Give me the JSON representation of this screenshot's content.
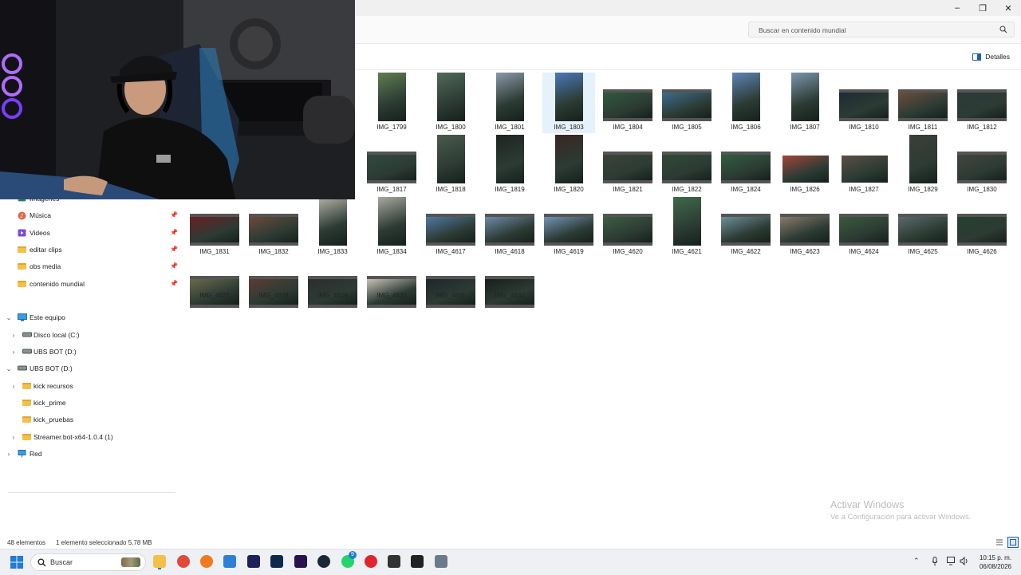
{
  "search": {
    "placeholder": "Buscar en contenido mundial"
  },
  "toolbar": {
    "details_label": "Detalles"
  },
  "sidebar": {
    "quick": [
      {
        "label": "Imágenes",
        "icon": "pictures-icon"
      },
      {
        "label": "Música",
        "icon": "music-icon"
      },
      {
        "label": "Videos",
        "icon": "videos-icon"
      },
      {
        "label": "editar clips",
        "icon": "folder-icon"
      },
      {
        "label": "obs media",
        "icon": "folder-icon"
      },
      {
        "label": "contenido mundial",
        "icon": "folder-icon"
      }
    ],
    "tree": [
      {
        "label": "Este equipo",
        "icon": "computer-icon"
      },
      {
        "label": "Disco local (C:)",
        "icon": "drive-icon"
      },
      {
        "label": "UBS BOT (D:)",
        "icon": "drive-icon"
      },
      {
        "label": "UBS BOT (D:)",
        "icon": "drive-icon"
      },
      {
        "label": "kick recursos",
        "icon": "folder-icon"
      },
      {
        "label": "kick_prime",
        "icon": "folder-icon"
      },
      {
        "label": "kick_pruebas",
        "icon": "folder-icon"
      },
      {
        "label": "Streamer.bot-x64-1.0.4 (1)",
        "icon": "folder-icon"
      },
      {
        "label": "Red",
        "icon": "network-icon"
      }
    ]
  },
  "files": [
    {
      "name": "IMG_1799",
      "type": "photo",
      "color": "#5f7d4f"
    },
    {
      "name": "IMG_1800",
      "type": "photo",
      "color": "#4f6a5a"
    },
    {
      "name": "IMG_1801",
      "type": "photo",
      "color": "#8a99a8"
    },
    {
      "name": "IMG_1803",
      "type": "photo",
      "color": "#4a78b8"
    },
    {
      "name": "IMG_1804",
      "type": "video",
      "color": "#2f5a3a"
    },
    {
      "name": "IMG_1805",
      "type": "video",
      "color": "#3c6d8c"
    },
    {
      "name": "IMG_1806",
      "type": "photo",
      "color": "#5d84b5"
    },
    {
      "name": "IMG_1807",
      "type": "photo",
      "color": "#7c96ad"
    },
    {
      "name": "IMG_1810",
      "type": "video",
      "color": "#1d2a35"
    },
    {
      "name": "IMG_1811",
      "type": "video",
      "color": "#6b4e3c"
    },
    {
      "name": "IMG_1812",
      "type": "video",
      "color": "#2c3a3a"
    },
    {
      "name": "IMG_1817",
      "type": "video",
      "color": "#324a40"
    },
    {
      "name": "IMG_1818",
      "type": "photo",
      "color": "#4b5a4c"
    },
    {
      "name": "IMG_1819",
      "type": "photo",
      "color": "#1f2420"
    },
    {
      "name": "IMG_1820",
      "type": "photo",
      "color": "#3a2524"
    },
    {
      "name": "IMG_1821",
      "type": "video",
      "color": "#3c4438"
    },
    {
      "name": "IMG_1822",
      "type": "video",
      "color": "#2f4a36"
    },
    {
      "name": "IMG_1824",
      "type": "video",
      "color": "#2e5f3c"
    },
    {
      "name": "IMG_1826",
      "type": "photo",
      "color": "#a0473a"
    },
    {
      "name": "IMG_1827",
      "type": "photo",
      "color": "#5a5042"
    },
    {
      "name": "IMG_1829",
      "type": "photo",
      "color": "#3a3f38"
    },
    {
      "name": "IMG_1830",
      "type": "video",
      "color": "#44443e"
    },
    {
      "name": "IMG_1831",
      "type": "video",
      "color": "#6a1f25"
    },
    {
      "name": "IMG_1832",
      "type": "video",
      "color": "#6b4a3a"
    },
    {
      "name": "IMG_1833",
      "type": "photo",
      "color": "#b5b2a8"
    },
    {
      "name": "IMG_1834",
      "type": "photo",
      "color": "#a8a89e"
    },
    {
      "name": "IMG_4617",
      "type": "video",
      "color": "#5178a4"
    },
    {
      "name": "IMG_4618",
      "type": "video",
      "color": "#6d8aa8"
    },
    {
      "name": "IMG_4619",
      "type": "video",
      "color": "#7394b8"
    },
    {
      "name": "IMG_4620",
      "type": "video",
      "color": "#3c5e42"
    },
    {
      "name": "IMG_4621",
      "type": "photo",
      "color": "#3e6a4a"
    },
    {
      "name": "IMG_4622",
      "type": "video",
      "color": "#6f8f9a"
    },
    {
      "name": "IMG_4623",
      "type": "video",
      "color": "#8a7a6a"
    },
    {
      "name": "IMG_4624",
      "type": "video",
      "color": "#3a5a3c"
    },
    {
      "name": "IMG_4625",
      "type": "video",
      "color": "#5a6a6a"
    },
    {
      "name": "IMG_4626",
      "type": "video",
      "color": "#26402e"
    },
    {
      "name": "IMG_4627",
      "type": "video",
      "color": "#6a6a4a"
    },
    {
      "name": "IMG_4628",
      "type": "video",
      "color": "#5a3c34"
    },
    {
      "name": "IMG_4629",
      "type": "video",
      "color": "#2e2c2e"
    },
    {
      "name": "IMG_4630",
      "type": "video",
      "color": "#c8c2b8"
    },
    {
      "name": "IMG_4631",
      "type": "video",
      "color": "#1e262a"
    },
    {
      "name": "IMG_4632",
      "type": "video",
      "color": "#1a1e1c"
    }
  ],
  "status": {
    "count": "48 elementos",
    "selection": "1 elemento seleccionado  5.78 MB"
  },
  "watermark": {
    "title": "Activar Windows",
    "subtitle": "Ve a Configuración para activar Windows."
  },
  "taskbar": {
    "search_label": "Buscar",
    "time": "10:15 p. m.",
    "date": "06/08/2026",
    "whatsapp_badge": "9",
    "apps": [
      {
        "name": "file-explorer-icon",
        "color": "#f5c04a"
      },
      {
        "name": "chrome-icon",
        "color": "#e04a3a"
      },
      {
        "name": "firefox-icon",
        "color": "#f07a20"
      },
      {
        "name": "store-icon",
        "color": "#2f7fd6"
      },
      {
        "name": "media-encoder-icon",
        "color": "#1f1f5a"
      },
      {
        "name": "photoshop-icon",
        "color": "#0d2a4a"
      },
      {
        "name": "premiere-icon",
        "color": "#2a1250"
      },
      {
        "name": "steam-icon",
        "color": "#1b2838"
      },
      {
        "name": "whatsapp-icon",
        "color": "#25d366"
      },
      {
        "name": "opera-icon",
        "color": "#e0252e"
      },
      {
        "name": "obs-icon",
        "color": "#333333"
      },
      {
        "name": "app-icon",
        "color": "#222222"
      },
      {
        "name": "settings-icon",
        "color": "#6a7a8a"
      }
    ]
  },
  "selected_file": "IMG_1803"
}
